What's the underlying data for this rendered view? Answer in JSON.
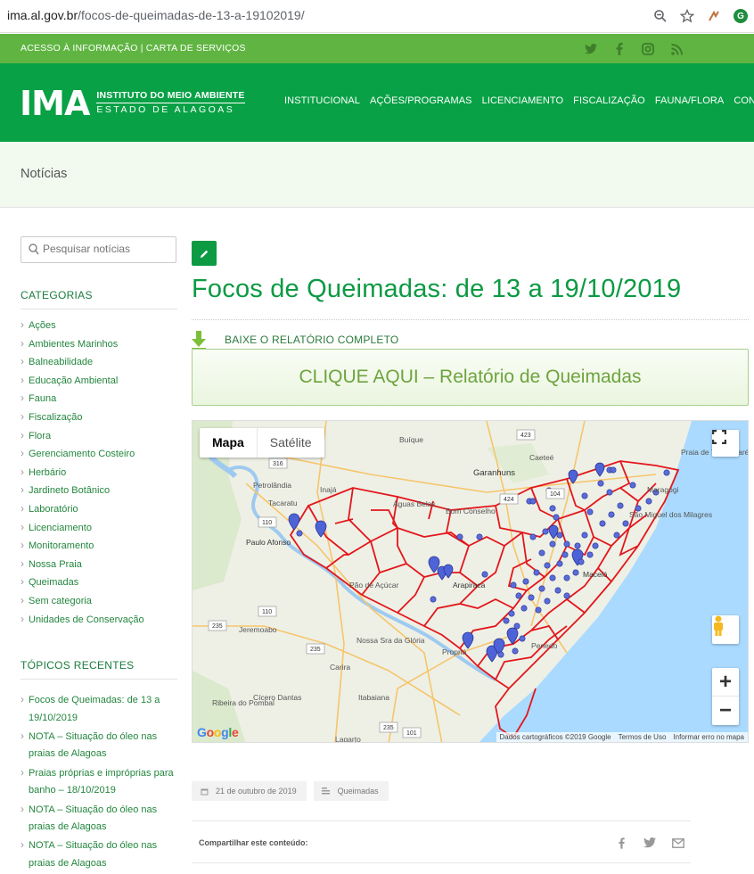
{
  "browser": {
    "url_host": "ima.al.gov.br",
    "url_path": "/focos-de-queimadas-de-13-a-19102019/"
  },
  "topbar": {
    "link_access": "ACESSO À INFORMAÇÃO",
    "separator": "|",
    "link_services": "CARTA DE SERVIÇOS"
  },
  "header": {
    "logo_main": "IMA",
    "logo_line1": "INSTITUTO DO MEIO AMBIENTE",
    "logo_line2": "ESTADO DE ALAGOAS",
    "nav": [
      "INSTITUCIONAL",
      "AÇÕES/PROGRAMAS",
      "LICENCIAMENTO",
      "FISCALIZAÇÃO",
      "FAUNA/FLORA",
      "CONTATO"
    ]
  },
  "band": {
    "title": "Notícias"
  },
  "sidebar": {
    "search_placeholder": "Pesquisar notícias",
    "categories_title": "CATEGORIAS",
    "categories": [
      "Ações",
      "Ambientes Marinhos",
      "Balneabilidade",
      "Educação Ambiental",
      "Fauna",
      "Fiscalização",
      "Flora",
      "Gerenciamento Costeiro",
      "Herbário",
      "Jardineto Botânico",
      "Laboratório",
      "Licenciamento",
      "Monitoramento",
      "Nossa Praia",
      "Queimadas",
      "Sem categoria",
      "Unidades de Conservação"
    ],
    "recent_title": "TÓPICOS RECENTES",
    "recent": [
      "Focos de Queimadas: de 13 a 19/10/2019",
      "NOTA – Situação do óleo nas praias de Alagoas",
      "Praias próprias e impróprias para banho – 18/10/2019",
      "NOTA – Situação do óleo nas praias de Alagoas",
      "NOTA – Situação do óleo nas praias de Alagoas"
    ]
  },
  "post": {
    "title": "Focos de Queimadas: de 13 a 19/10/2019",
    "download_label": "BAIXE O RELATÓRIO COMPLETO",
    "button_label": "CLIQUE AQUI – Relatório de Queimadas",
    "date": "21 de outubro de 2019",
    "category": "Queimadas",
    "share_label": "Compartilhar este conteúdo:"
  },
  "map": {
    "tab_map": "Mapa",
    "tab_satellite": "Satélite",
    "credits": "Dados cartográficos ©2019 Google",
    "terms": "Termos de Uso",
    "report": "Informar erro no mapa",
    "google": "Google",
    "zoom_in": "+",
    "zoom_out": "−",
    "places": [
      "Buíque",
      "Garanhuns",
      "Caeteé",
      "Petrolândia",
      "Inajá",
      "Tacaratu",
      "Águas Belas",
      "Bom Conselho",
      "Paulo Afonso",
      "Arapiraca",
      "Jeremoabo",
      "Nossa Sra da Glória",
      "Carira",
      "Cícero Dantas",
      "Itabaiana",
      "Ribeira do Pombal",
      "Lagarto",
      "Maceió",
      "Penedo",
      "Propriá",
      "Maragogi",
      "Pão de Açúcar",
      "Praia de Tamandaré",
      "São Miguel dos Milagres"
    ],
    "roads": [
      "316",
      "423",
      "424",
      "104",
      "110",
      "235",
      "101"
    ]
  },
  "colors": {
    "header_green": "#08a146",
    "strip_green": "#60b542",
    "accent_green": "#0c9a43",
    "boundary_red": "#e3161b",
    "marker_blue": "#4f63d8"
  }
}
